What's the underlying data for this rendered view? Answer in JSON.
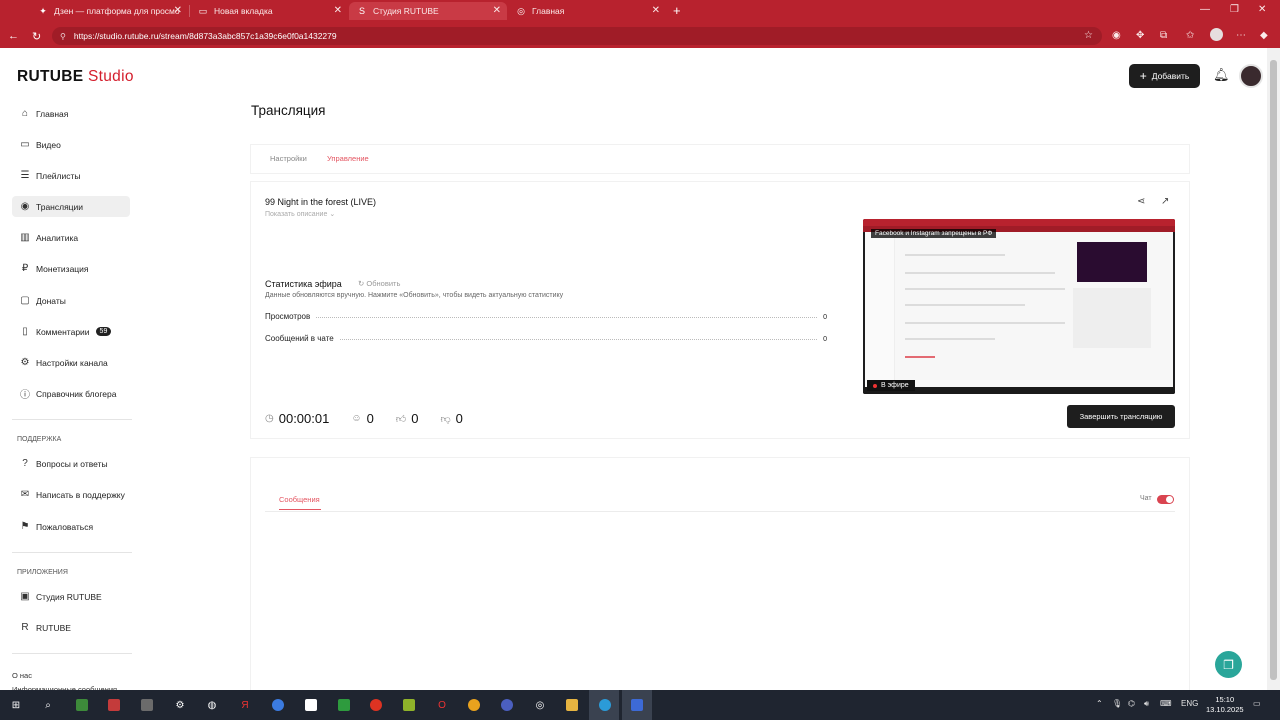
{
  "browser": {
    "tabs": [
      {
        "label": "Дзен — платформа для просмо",
        "icon": "dzen-icon"
      },
      {
        "label": "Новая вкладка",
        "icon": "newtab-icon"
      },
      {
        "label": "Студия RUTUBE",
        "icon": "rutube-icon",
        "active": true
      },
      {
        "label": "Главная",
        "icon": "globe-icon"
      }
    ],
    "url": "https://studio.rutube.ru/stream/8d873a3abc857c1a39c6e0f0a1432279"
  },
  "logo": {
    "brand": "RUTUBE",
    "studio": "Studio"
  },
  "sidebar": {
    "items": [
      {
        "label": "Главная",
        "icon": "home-icon"
      },
      {
        "label": "Видео",
        "icon": "video-icon"
      },
      {
        "label": "Плейлисты",
        "icon": "playlist-icon"
      },
      {
        "label": "Трансляции",
        "icon": "broadcast-icon",
        "active": true
      },
      {
        "label": "Аналитика",
        "icon": "analytics-icon"
      },
      {
        "label": "Монетизация",
        "icon": "monetization-icon"
      },
      {
        "label": "Донаты",
        "icon": "donate-icon"
      },
      {
        "label": "Комментарии",
        "icon": "comments-icon",
        "badge": "59"
      },
      {
        "label": "Настройки канала",
        "icon": "settings-icon"
      },
      {
        "label": "Справочник блогера",
        "icon": "info-icon"
      }
    ],
    "support_heading": "ПОДДЕРЖКА",
    "support_items": [
      {
        "label": "Вопросы и ответы",
        "icon": "help-icon"
      },
      {
        "label": "Написать в поддержку",
        "icon": "mail-icon"
      },
      {
        "label": "Пожаловаться",
        "icon": "flag-icon"
      }
    ],
    "apps_heading": "ПРИЛОЖЕНИЯ",
    "apps_items": [
      {
        "label": "Студия RUTUBE",
        "icon": "studio-app-icon"
      },
      {
        "label": "RUTUBE",
        "icon": "rutube-app-icon"
      }
    ],
    "footer": [
      "О нас",
      "Информационные сообщения"
    ]
  },
  "header": {
    "add_label": "Добавить"
  },
  "page": {
    "title": "Трансляция",
    "tabs": [
      {
        "label": "Настройки"
      },
      {
        "label": "Управление",
        "active": true
      }
    ]
  },
  "stream": {
    "title": "99 Night in the forest (LIVE)",
    "show_description": "Показать описание",
    "stats_title": "Статистика эфира",
    "refresh": "Обновить",
    "stats_note": "Данные обновляются вручную. Нажмите «Обновить», чтобы видеть актуальную статистику",
    "stats": [
      {
        "label": "Просмотров",
        "value": "0"
      },
      {
        "label": "Сообщений в чате",
        "value": "0"
      }
    ],
    "duration": "00:00:01",
    "viewers": "0",
    "likes": "0",
    "dislikes": "0",
    "preview_banner": "Facebook и Instagram запрещены в РФ",
    "live_label": "В эфире",
    "end_button": "Завершить трансляцию"
  },
  "chat": {
    "tab": "Сообщения",
    "toggle_label": "Чат",
    "toggle_on": true
  },
  "taskbar": {
    "lang": "ENG",
    "time": "15:10",
    "date": "13.10.2025"
  },
  "colors": {
    "browser": "#b8222e",
    "accent": "#e45561",
    "dark_button": "#1e1e1e",
    "help_fab": "#2aa69a"
  }
}
